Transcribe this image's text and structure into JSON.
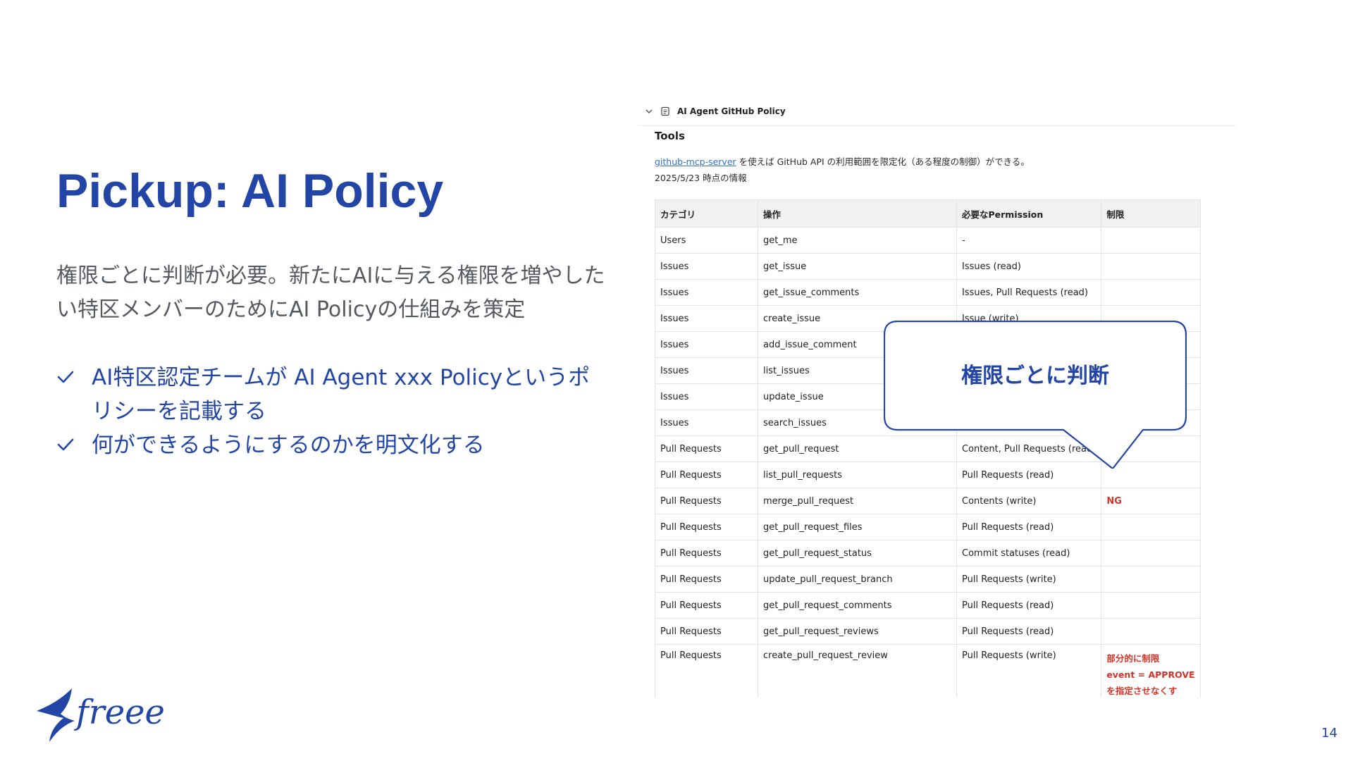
{
  "slide": {
    "title": "Pickup: AI Policy",
    "description": "権限ごとに判断が必要。新たにAIに与える権限を増やしたい特区メンバーのためにAI Policyの仕組みを策定",
    "bullets": [
      "AI特区認定チームが AI Agent xxx Policyというポリシーを記載する",
      "何ができるようにするのかを明文化する"
    ],
    "page_number": "14",
    "logo_text": "freee",
    "brand_color": "#2346a6"
  },
  "panel": {
    "doc_title": "AI Agent GitHub Policy",
    "section": "Tools",
    "link_text": "github-mcp-server",
    "note_suffix": " を使えば GitHub API の利用範囲を限定化（ある程度の制御）ができる。",
    "date_note": "2025/5/23 時点の情報",
    "columns": [
      "カテゴリ",
      "操作",
      "必要なPermission",
      "制限"
    ],
    "rows": [
      [
        "Users",
        "get_me",
        "-",
        ""
      ],
      [
        "Issues",
        "get_issue",
        "Issues (read)",
        ""
      ],
      [
        "Issues",
        "get_issue_comments",
        "Issues, Pull Requests (read)",
        ""
      ],
      [
        "Issues",
        "create_issue",
        "Issue (write)",
        ""
      ],
      [
        "Issues",
        "add_issue_comment",
        "",
        ""
      ],
      [
        "Issues",
        "list_issues",
        "",
        ""
      ],
      [
        "Issues",
        "update_issue",
        "",
        ""
      ],
      [
        "Issues",
        "search_issues",
        "",
        ""
      ],
      [
        "Pull Requests",
        "get_pull_request",
        "Content, Pull Requests (read)",
        ""
      ],
      [
        "Pull Requests",
        "list_pull_requests",
        "Pull Requests (read)",
        ""
      ],
      [
        "Pull Requests",
        "merge_pull_request",
        "Contents (write)",
        "NG"
      ],
      [
        "Pull Requests",
        "get_pull_request_files",
        "Pull Requests (read)",
        ""
      ],
      [
        "Pull Requests",
        "get_pull_request_status",
        "Commit statuses (read)",
        ""
      ],
      [
        "Pull Requests",
        "update_pull_request_branch",
        "Pull Requests (write)",
        ""
      ],
      [
        "Pull Requests",
        "get_pull_request_comments",
        "Pull Requests (read)",
        ""
      ],
      [
        "Pull Requests",
        "get_pull_request_reviews",
        "Pull Requests (read)",
        ""
      ]
    ],
    "last_row": {
      "category": "Pull Requests",
      "operation": "create_pull_request_review",
      "permission": "Pull Requests (write)",
      "limit_lines": [
        "部分的に制限",
        "event = APPROVE",
        "を指定させなくす"
      ]
    },
    "limit_color": "#d0352b"
  },
  "callout": {
    "text": "権限ごとに判断"
  }
}
